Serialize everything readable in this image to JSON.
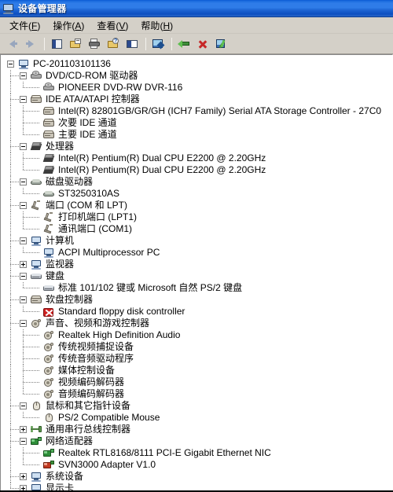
{
  "window": {
    "title": "设备管理器",
    "title_icon": "computer-monitor-icon"
  },
  "menubar": {
    "items": [
      {
        "label": "文件",
        "accel": "F"
      },
      {
        "label": "操作",
        "accel": "A"
      },
      {
        "label": "查看",
        "accel": "V"
      },
      {
        "label": "帮助",
        "accel": "H"
      }
    ]
  },
  "toolbar": {
    "buttons": [
      {
        "name": "back-button",
        "icon": "left-arrow-icon"
      },
      {
        "name": "forward-button",
        "icon": "right-arrow-icon"
      },
      {
        "name": "show-hide-tree-button",
        "icon": "tree-pane-icon"
      },
      {
        "name": "properties-button",
        "icon": "properties-icon"
      },
      {
        "name": "print-button",
        "icon": "printer-icon"
      },
      {
        "name": "help-button",
        "icon": "help-properties-icon"
      },
      {
        "name": "view-toggle-button",
        "icon": "split-view-icon"
      },
      {
        "name": "scan-hardware-button",
        "icon": "scan-hardware-icon"
      },
      {
        "name": "update-driver-button",
        "icon": "update-driver-icon"
      },
      {
        "name": "uninstall-button",
        "icon": "uninstall-red-x-icon"
      },
      {
        "name": "enable-device-button",
        "icon": "enable-green-check-icon"
      }
    ]
  },
  "tree": {
    "root": {
      "label": "PC-201103101136",
      "icon": "computer-icon",
      "expander": "minus"
    },
    "nodes": [
      {
        "level": 1,
        "label": "DVD/CD-ROM 驱动器",
        "icon": "dvd-drive-icon",
        "expander": "minus"
      },
      {
        "level": 2,
        "label": "PIONEER DVD-RW  DVR-116",
        "icon": "dvd-drive-icon",
        "expander": "none"
      },
      {
        "level": 1,
        "label": "IDE ATA/ATAPI 控制器",
        "icon": "ide-controller-icon",
        "expander": "minus"
      },
      {
        "level": 2,
        "label": "Intel(R) 82801GB/GR/GH (ICH7 Family) Serial ATA Storage Controller - 27C0",
        "icon": "ide-controller-icon",
        "expander": "none"
      },
      {
        "level": 2,
        "label": "次要 IDE 通道",
        "icon": "ide-controller-icon",
        "expander": "none"
      },
      {
        "level": 2,
        "label": "主要 IDE 通道",
        "icon": "ide-controller-icon",
        "expander": "none"
      },
      {
        "level": 1,
        "label": "处理器",
        "icon": "cpu-icon",
        "expander": "minus"
      },
      {
        "level": 2,
        "label": "Intel(R) Pentium(R) Dual  CPU  E2200  @ 2.20GHz",
        "icon": "cpu-icon",
        "expander": "none"
      },
      {
        "level": 2,
        "label": "Intel(R) Pentium(R) Dual  CPU  E2200  @ 2.20GHz",
        "icon": "cpu-icon",
        "expander": "none"
      },
      {
        "level": 1,
        "label": "磁盘驱动器",
        "icon": "disk-drive-icon",
        "expander": "minus"
      },
      {
        "level": 2,
        "label": "ST3250310AS",
        "icon": "disk-drive-icon",
        "expander": "none"
      },
      {
        "level": 1,
        "label": "端口 (COM 和 LPT)",
        "icon": "port-icon",
        "expander": "minus"
      },
      {
        "level": 2,
        "label": "打印机端口 (LPT1)",
        "icon": "port-icon",
        "expander": "none"
      },
      {
        "level": 2,
        "label": "通讯端口 (COM1)",
        "icon": "port-icon",
        "expander": "none"
      },
      {
        "level": 1,
        "label": "计算机",
        "icon": "computer-icon",
        "expander": "minus"
      },
      {
        "level": 2,
        "label": "ACPI Multiprocessor PC",
        "icon": "computer-icon",
        "expander": "none"
      },
      {
        "level": 1,
        "label": "监视器",
        "icon": "computer-icon",
        "expander": "plus"
      },
      {
        "level": 1,
        "label": "键盘",
        "icon": "keyboard-icon",
        "expander": "minus"
      },
      {
        "level": 2,
        "label": "标准 101/102 键或 Microsoft 自然 PS/2 键盘",
        "icon": "keyboard-icon",
        "expander": "none"
      },
      {
        "level": 1,
        "label": "软盘控制器",
        "icon": "ide-controller-icon",
        "expander": "minus"
      },
      {
        "level": 2,
        "label": "Standard floppy disk controller",
        "icon": "error-red-x-icon",
        "expander": "none",
        "error": true
      },
      {
        "level": 1,
        "label": "声音、视频和游戏控制器",
        "icon": "sound-icon",
        "expander": "minus"
      },
      {
        "level": 2,
        "label": "Realtek High Definition Audio",
        "icon": "sound-icon",
        "expander": "none"
      },
      {
        "level": 2,
        "label": "传统视频捕捉设备",
        "icon": "sound-icon",
        "expander": "none"
      },
      {
        "level": 2,
        "label": "传统音频驱动程序",
        "icon": "sound-icon",
        "expander": "none"
      },
      {
        "level": 2,
        "label": "媒体控制设备",
        "icon": "sound-icon",
        "expander": "none"
      },
      {
        "level": 2,
        "label": "视频编码解码器",
        "icon": "sound-icon",
        "expander": "none"
      },
      {
        "level": 2,
        "label": "音频编码解码器",
        "icon": "sound-icon",
        "expander": "none"
      },
      {
        "level": 1,
        "label": "鼠标和其它指针设备",
        "icon": "mouse-icon",
        "expander": "minus"
      },
      {
        "level": 2,
        "label": "PS/2 Compatible Mouse",
        "icon": "mouse-icon",
        "expander": "none"
      },
      {
        "level": 1,
        "label": "通用串行总线控制器",
        "icon": "usb-icon",
        "expander": "plus"
      },
      {
        "level": 1,
        "label": "网络适配器",
        "icon": "network-icon",
        "expander": "minus"
      },
      {
        "level": 2,
        "label": "Realtek RTL8168/8111 PCI-E Gigabit Ethernet NIC",
        "icon": "network-icon",
        "expander": "none"
      },
      {
        "level": 2,
        "label": "SVN3000 Adapter V1.0",
        "icon": "network-red-icon",
        "expander": "none"
      },
      {
        "level": 1,
        "label": "系统设备",
        "icon": "computer-icon",
        "expander": "plus"
      },
      {
        "level": 1,
        "label": "显示卡",
        "icon": "computer-icon",
        "expander": "plus"
      }
    ]
  },
  "colors": {
    "titlebar_blue": "#2f7ce8",
    "chrome_gray": "#d4d0c8",
    "tree_background": "#ffffff",
    "selection_blue": "#316ac5",
    "error_red": "#cf2020",
    "network_green": "#2f8f3a"
  }
}
